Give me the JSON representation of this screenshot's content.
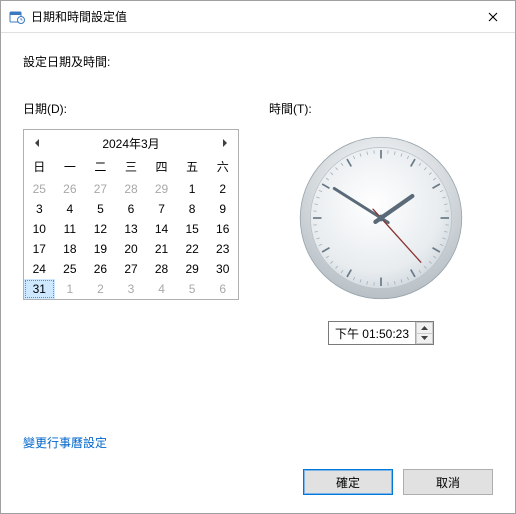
{
  "titlebar": {
    "title": "日期和時間設定值"
  },
  "body": {
    "set_label": "設定日期及時間:",
    "date_label": "日期(D):",
    "time_label": "時間(T):"
  },
  "calendar": {
    "month_title": "2024年3月",
    "dow": [
      "日",
      "一",
      "二",
      "三",
      "四",
      "五",
      "六"
    ],
    "weeks": [
      [
        {
          "n": "25",
          "g": true
        },
        {
          "n": "26",
          "g": true
        },
        {
          "n": "27",
          "g": true
        },
        {
          "n": "28",
          "g": true
        },
        {
          "n": "29",
          "g": true
        },
        {
          "n": "1"
        },
        {
          "n": "2"
        }
      ],
      [
        {
          "n": "3"
        },
        {
          "n": "4"
        },
        {
          "n": "5"
        },
        {
          "n": "6"
        },
        {
          "n": "7"
        },
        {
          "n": "8"
        },
        {
          "n": "9"
        }
      ],
      [
        {
          "n": "10"
        },
        {
          "n": "11"
        },
        {
          "n": "12"
        },
        {
          "n": "13"
        },
        {
          "n": "14"
        },
        {
          "n": "15"
        },
        {
          "n": "16"
        }
      ],
      [
        {
          "n": "17"
        },
        {
          "n": "18"
        },
        {
          "n": "19"
        },
        {
          "n": "20"
        },
        {
          "n": "21"
        },
        {
          "n": "22"
        },
        {
          "n": "23"
        }
      ],
      [
        {
          "n": "24"
        },
        {
          "n": "25"
        },
        {
          "n": "26"
        },
        {
          "n": "27"
        },
        {
          "n": "28"
        },
        {
          "n": "29"
        },
        {
          "n": "30"
        }
      ],
      [
        {
          "n": "31",
          "sel": true
        },
        {
          "n": "1",
          "g": true
        },
        {
          "n": "2",
          "g": true
        },
        {
          "n": "3",
          "g": true
        },
        {
          "n": "4",
          "g": true
        },
        {
          "n": "5",
          "g": true
        },
        {
          "n": "6",
          "g": true
        }
      ]
    ]
  },
  "time": {
    "value": "下午 01:50:23",
    "hours": 1,
    "minutes": 50,
    "seconds": 23,
    "pm": true
  },
  "link": {
    "label": "變更行事曆設定"
  },
  "footer": {
    "ok": "確定",
    "cancel": "取消"
  },
  "colors": {
    "accent": "#0078d7",
    "link": "#0066cc"
  }
}
